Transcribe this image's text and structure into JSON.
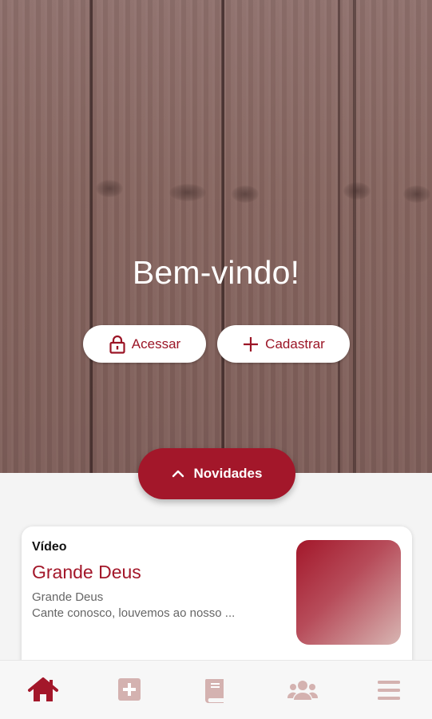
{
  "hero": {
    "welcome": "Bem-vindo!",
    "access_label": "Acessar",
    "register_label": "Cadastrar"
  },
  "news_toggle": {
    "label": "Novidades"
  },
  "card": {
    "type": "Vídeo",
    "title": "Grande Deus",
    "subtitle": "Grande Deus",
    "description": "Cante conosco, louvemos ao nosso ..."
  },
  "bottom_nav": {
    "items": [
      {
        "icon": "home-icon",
        "active": true
      },
      {
        "icon": "plus-square-icon",
        "active": false
      },
      {
        "icon": "book-icon",
        "active": false
      },
      {
        "icon": "users-icon",
        "active": false
      },
      {
        "icon": "menu-icon",
        "active": false
      }
    ]
  },
  "colors": {
    "accent": "#a3172a",
    "inactive_icon": "#d4b2b0",
    "wood": "#8a6a66"
  }
}
